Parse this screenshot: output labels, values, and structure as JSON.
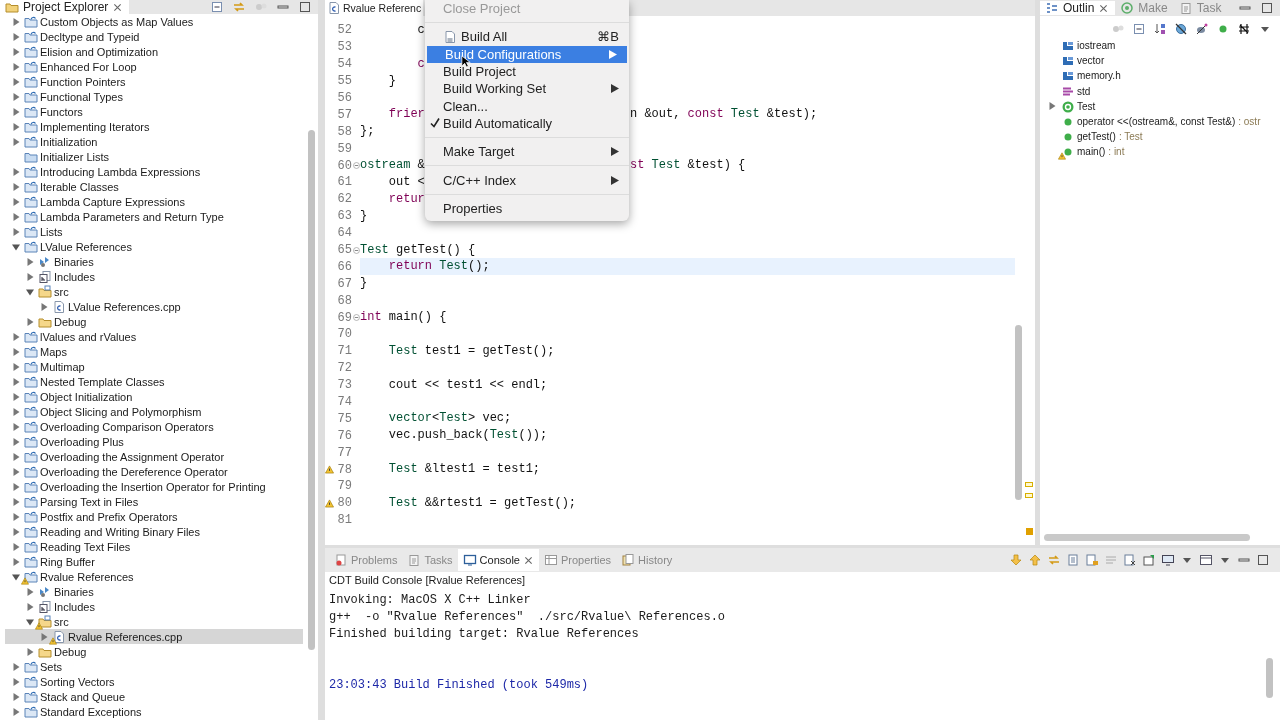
{
  "project_explorer": {
    "tab": {
      "label": "Project Explorer"
    },
    "tree": [
      {
        "label": "Custom Objects as Map Values",
        "kind": "project",
        "expanded": false,
        "selected": false,
        "warning": false
      },
      {
        "label": "Decltype and Typeid",
        "kind": "project",
        "expanded": false,
        "selected": false,
        "warning": false
      },
      {
        "label": "Elision and Optimization",
        "kind": "project",
        "expanded": false,
        "selected": false,
        "warning": false
      },
      {
        "label": "Enhanced For Loop",
        "kind": "project",
        "expanded": false,
        "selected": false,
        "warning": false
      },
      {
        "label": "Function Pointers",
        "kind": "project",
        "expanded": false,
        "selected": false,
        "warning": false
      },
      {
        "label": "Functional Types",
        "kind": "project",
        "expanded": false,
        "selected": false,
        "warning": false
      },
      {
        "label": "Functors",
        "kind": "project",
        "expanded": false,
        "selected": false,
        "warning": false
      },
      {
        "label": "Implementing Iterators",
        "kind": "project",
        "expanded": false,
        "selected": false,
        "warning": false
      },
      {
        "label": "Initialization",
        "kind": "project",
        "expanded": false,
        "selected": false,
        "warning": false
      },
      {
        "label": "Initializer Lists",
        "kind": "closed",
        "selected": false,
        "warning": false
      },
      {
        "label": "Introducing Lambda Expressions",
        "kind": "project",
        "expanded": false,
        "selected": false,
        "warning": false
      },
      {
        "label": "Iterable Classes",
        "kind": "project",
        "expanded": false,
        "selected": false,
        "warning": false
      },
      {
        "label": "Lambda Capture Expressions",
        "kind": "project",
        "expanded": false,
        "selected": false,
        "warning": false
      },
      {
        "label": "Lambda Parameters and Return Type",
        "kind": "project",
        "expanded": false,
        "selected": false,
        "warning": false
      },
      {
        "label": "Lists",
        "kind": "project",
        "expanded": false,
        "selected": false,
        "warning": false
      },
      {
        "label": "LValue References",
        "kind": "project",
        "expanded": true,
        "selected": false,
        "warning": false,
        "children": [
          {
            "label": "Binaries",
            "kind": "binaries",
            "expanded": false,
            "selected": false,
            "warning": false
          },
          {
            "label": "Includes",
            "kind": "includes",
            "expanded": false,
            "selected": false,
            "warning": false
          },
          {
            "label": "src",
            "kind": "src",
            "expanded": true,
            "selected": false,
            "warning": false,
            "children": [
              {
                "label": "LValue References.cpp",
                "kind": "cpp",
                "expanded": false,
                "selected": false,
                "warning": false
              }
            ]
          },
          {
            "label": "Debug",
            "kind": "folder",
            "expanded": false,
            "selected": false,
            "warning": false
          }
        ]
      },
      {
        "label": "lValues and rValues",
        "kind": "project",
        "expanded": false,
        "selected": false,
        "warning": false
      },
      {
        "label": "Maps",
        "kind": "project",
        "expanded": false,
        "selected": false,
        "warning": false
      },
      {
        "label": "Multimap",
        "kind": "project",
        "expanded": false,
        "selected": false,
        "warning": false
      },
      {
        "label": "Nested Template Classes",
        "kind": "project",
        "expanded": false,
        "selected": false,
        "warning": false
      },
      {
        "label": "Object Initialization",
        "kind": "project",
        "expanded": false,
        "selected": false,
        "warning": false
      },
      {
        "label": "Object Slicing and Polymorphism",
        "kind": "project",
        "expanded": false,
        "selected": false,
        "warning": false
      },
      {
        "label": "Overloading Comparison Operators",
        "kind": "project",
        "expanded": false,
        "selected": false,
        "warning": false
      },
      {
        "label": "Overloading Plus",
        "kind": "project",
        "expanded": false,
        "selected": false,
        "warning": false
      },
      {
        "label": "Overloading the Assignment Operator",
        "kind": "project",
        "expanded": false,
        "selected": false,
        "warning": false
      },
      {
        "label": "Overloading the Dereference Operator",
        "kind": "project",
        "expanded": false,
        "selected": false,
        "warning": false
      },
      {
        "label": "Overloading the Insertion Operator for Printing",
        "kind": "project",
        "expanded": false,
        "selected": false,
        "warning": false
      },
      {
        "label": "Parsing Text in Files",
        "kind": "project",
        "expanded": false,
        "selected": false,
        "warning": false
      },
      {
        "label": "Postfix and Prefix Operators",
        "kind": "project",
        "expanded": false,
        "selected": false,
        "warning": false
      },
      {
        "label": "Reading and Writing Binary Files",
        "kind": "project",
        "expanded": false,
        "selected": false,
        "warning": false
      },
      {
        "label": "Reading Text Files",
        "kind": "project",
        "expanded": false,
        "selected": false,
        "warning": false
      },
      {
        "label": "Ring Buffer",
        "kind": "project",
        "expanded": false,
        "selected": false,
        "warning": false
      },
      {
        "label": "Rvalue References",
        "kind": "project",
        "expanded": true,
        "selected": false,
        "warning": true,
        "children": [
          {
            "label": "Binaries",
            "kind": "binaries",
            "expanded": false,
            "selected": false,
            "warning": false
          },
          {
            "label": "Includes",
            "kind": "includes",
            "expanded": false,
            "selected": false,
            "warning": false
          },
          {
            "label": "src",
            "kind": "src",
            "expanded": true,
            "selected": false,
            "warning": true,
            "children": [
              {
                "label": "Rvalue References.cpp",
                "kind": "cpp",
                "expanded": false,
                "selected": true,
                "warning": true
              }
            ]
          },
          {
            "label": "Debug",
            "kind": "folder",
            "expanded": false,
            "selected": false,
            "warning": false
          }
        ]
      },
      {
        "label": "Sets",
        "kind": "project",
        "expanded": false,
        "selected": false,
        "warning": false
      },
      {
        "label": "Sorting Vectors",
        "kind": "project",
        "expanded": false,
        "selected": false,
        "warning": false
      },
      {
        "label": "Stack and Queue",
        "kind": "project",
        "expanded": false,
        "selected": false,
        "warning": false
      },
      {
        "label": "Standard Exceptions",
        "kind": "project",
        "expanded": false,
        "selected": false,
        "warning": false
      }
    ]
  },
  "editor": {
    "tab": {
      "label": "Rvalue Referenc"
    },
    "lines": [
      {
        "number": "52",
        "kind": "plain",
        "current": false,
        "tokens": [
          {
            "text": "        c",
            "kind": "plain"
          }
        ]
      },
      {
        "number": "53",
        "kind": "plain",
        "current": false
      },
      {
        "number": "54",
        "kind": "plain",
        "current": false,
        "tokens": [
          {
            "text": "        c",
            "kind": "keyword"
          }
        ]
      },
      {
        "number": "55",
        "kind": "plain",
        "current": false,
        "tokens": [
          {
            "text": "    }",
            "kind": "plain"
          }
        ]
      },
      {
        "number": "56",
        "kind": "plain",
        "current": false
      },
      {
        "number": "57",
        "kind": "plain",
        "current": false,
        "tokens": [
          {
            "text": "    frier",
            "kind": "keyword"
          }
        ],
        "tokens_after_menu": [
          {
            "text": "n &out, ",
            "kind": "plain"
          },
          {
            "text": "const ",
            "kind": "keyword"
          },
          {
            "text": "Test",
            "kind": "type"
          },
          {
            "text": " &test);",
            "kind": "plain"
          }
        ]
      },
      {
        "number": "58",
        "kind": "plain",
        "current": false,
        "tokens": [
          {
            "text": "};",
            "kind": "plain"
          }
        ]
      },
      {
        "number": "59",
        "kind": "plain",
        "current": false
      },
      {
        "number": "60",
        "kind": "fold",
        "current": false,
        "tokens": [
          {
            "text": "ostream",
            "kind": "type"
          },
          {
            "text": " &",
            "kind": "plain"
          }
        ],
        "tokens_after_menu": [
          {
            "text": "st ",
            "kind": "keyword"
          },
          {
            "text": "Test",
            "kind": "type"
          },
          {
            "text": " &test) {",
            "kind": "plain"
          }
        ]
      },
      {
        "number": "61",
        "kind": "plain",
        "current": false,
        "tokens": [
          {
            "text": "    out <",
            "kind": "plain"
          }
        ]
      },
      {
        "number": "62",
        "kind": "plain",
        "current": false,
        "tokens": [
          {
            "text": "    retur",
            "kind": "keyword"
          }
        ]
      },
      {
        "number": "63",
        "kind": "plain",
        "current": false,
        "tokens": [
          {
            "text": "}",
            "kind": "plain"
          }
        ]
      },
      {
        "number": "64",
        "kind": "plain",
        "current": false
      },
      {
        "number": "65",
        "kind": "fold",
        "current": false,
        "tokens": [
          {
            "text": "Test",
            "kind": "type"
          },
          {
            "text": " getTest() {",
            "kind": "plain"
          }
        ]
      },
      {
        "number": "66",
        "kind": "plain",
        "current": true,
        "tokens": [
          {
            "text": "    return ",
            "kind": "keyword"
          },
          {
            "text": "Test",
            "kind": "type"
          },
          {
            "text": "();",
            "kind": "plain"
          }
        ]
      },
      {
        "number": "67",
        "kind": "plain",
        "current": false,
        "tokens": [
          {
            "text": "}",
            "kind": "plain"
          }
        ]
      },
      {
        "number": "68",
        "kind": "plain",
        "current": false
      },
      {
        "number": "69",
        "kind": "fold",
        "current": false,
        "tokens": [
          {
            "text": "int",
            "kind": "keyword"
          },
          {
            "text": " main() {",
            "kind": "plain"
          }
        ]
      },
      {
        "number": "70",
        "kind": "plain",
        "current": false
      },
      {
        "number": "71",
        "kind": "plain",
        "current": false,
        "tokens": [
          {
            "text": "    Test",
            "kind": "type"
          },
          {
            "text": " test1 = getTest();",
            "kind": "plain"
          }
        ]
      },
      {
        "number": "72",
        "kind": "plain",
        "current": false
      },
      {
        "number": "73",
        "kind": "plain",
        "current": false,
        "tokens": [
          {
            "text": "    cout << test1 << endl;",
            "kind": "plain"
          }
        ]
      },
      {
        "number": "74",
        "kind": "plain",
        "current": false
      },
      {
        "number": "75",
        "kind": "plain",
        "current": false,
        "tokens": [
          {
            "text": "    vector",
            "kind": "type"
          },
          {
            "text": "<",
            "kind": "plain"
          },
          {
            "text": "Test",
            "kind": "type"
          },
          {
            "text": "> vec;",
            "kind": "plain"
          }
        ]
      },
      {
        "number": "76",
        "kind": "plain",
        "current": false,
        "tokens": [
          {
            "text": "    vec.push_back(",
            "kind": "plain"
          },
          {
            "text": "Test",
            "kind": "type"
          },
          {
            "text": "());",
            "kind": "plain"
          }
        ]
      },
      {
        "number": "77",
        "kind": "plain",
        "current": false
      },
      {
        "number": "78",
        "kind": "warning",
        "current": false,
        "tokens": [
          {
            "text": "    Test",
            "kind": "type"
          },
          {
            "text": " &ltest1 = test1;",
            "kind": "plain"
          }
        ]
      },
      {
        "number": "79",
        "kind": "plain",
        "current": false
      },
      {
        "number": "80",
        "kind": "warning",
        "current": false,
        "tokens": [
          {
            "text": "    Test",
            "kind": "type"
          },
          {
            "text": " &&rtest1 = getTest();",
            "kind": "plain"
          }
        ]
      },
      {
        "number": "81",
        "kind": "plain",
        "current": false
      }
    ]
  },
  "context_menu": {
    "sections": [
      {
        "items": [
          {
            "label": "Close Project",
            "kind": "plain",
            "disabled": true,
            "selected": false,
            "checked": false,
            "submenu": false
          }
        ]
      },
      {
        "items": [
          {
            "label": "Build All",
            "kind": "build",
            "shortcut": "⌘B",
            "disabled": false,
            "selected": false,
            "checked": false,
            "submenu": false
          },
          {
            "label": "Build Configurations",
            "kind": "plain",
            "disabled": false,
            "selected": true,
            "checked": false,
            "submenu": true
          },
          {
            "label": "Build Project",
            "kind": "plain",
            "disabled": false,
            "selected": false,
            "checked": false,
            "submenu": false
          },
          {
            "label": "Build Working Set",
            "kind": "plain",
            "disabled": false,
            "selected": false,
            "checked": false,
            "submenu": true
          },
          {
            "label": "Clean...",
            "kind": "plain",
            "disabled": false,
            "selected": false,
            "checked": false,
            "submenu": false
          },
          {
            "label": "Build Automatically",
            "kind": "plain",
            "disabled": false,
            "selected": false,
            "checked": true,
            "submenu": false
          }
        ]
      },
      {
        "items": [
          {
            "label": "Make Target",
            "kind": "plain",
            "disabled": false,
            "selected": false,
            "checked": false,
            "submenu": true
          }
        ]
      },
      {
        "items": [
          {
            "label": "C/C++ Index",
            "kind": "plain",
            "disabled": false,
            "selected": false,
            "checked": false,
            "submenu": true
          }
        ]
      },
      {
        "items": [
          {
            "label": "Properties",
            "kind": "plain",
            "disabled": false,
            "selected": false,
            "checked": false,
            "submenu": false
          }
        ]
      }
    ]
  },
  "outline": {
    "tabs": [
      {
        "label": "Outlin",
        "selected": true
      },
      {
        "label": "Make",
        "selected": false
      },
      {
        "label": "Task",
        "selected": false
      }
    ],
    "items": [
      {
        "label": "iostream",
        "kind": "include",
        "warning": false
      },
      {
        "label": "vector",
        "kind": "include",
        "warning": false
      },
      {
        "label": "memory.h",
        "kind": "include",
        "warning": false
      },
      {
        "label": "std",
        "kind": "namespace",
        "warning": false
      },
      {
        "label": "Test",
        "kind": "class",
        "expanded": false,
        "warning": false
      },
      {
        "label": "operator <<(ostream&, const Test&)",
        "type": ": ostr",
        "kind": "function",
        "warning": false
      },
      {
        "label": "getTest()",
        "type": ": Test",
        "kind": "function",
        "warning": false
      },
      {
        "label": "main()",
        "type": ": int",
        "kind": "function",
        "warning": true
      }
    ]
  },
  "console": {
    "tabs": [
      {
        "label": "Problems",
        "selected": false
      },
      {
        "label": "Tasks",
        "selected": false
      },
      {
        "label": "Console",
        "selected": true
      },
      {
        "label": "Properties",
        "selected": false
      },
      {
        "label": "History",
        "selected": false
      }
    ],
    "title": "CDT Build Console [Rvalue References]",
    "lines": [
      {
        "text": "Invoking: MacOS X C++ Linker",
        "kind": "output"
      },
      {
        "text": "g++  -o \"Rvalue References\"  ./src/Rvalue\\ References.o",
        "kind": "output"
      },
      {
        "text": "Finished building target: Rvalue References",
        "kind": "output"
      },
      {
        "text": "23:03:43 Build Finished (took 549ms)",
        "kind": "status"
      }
    ]
  }
}
